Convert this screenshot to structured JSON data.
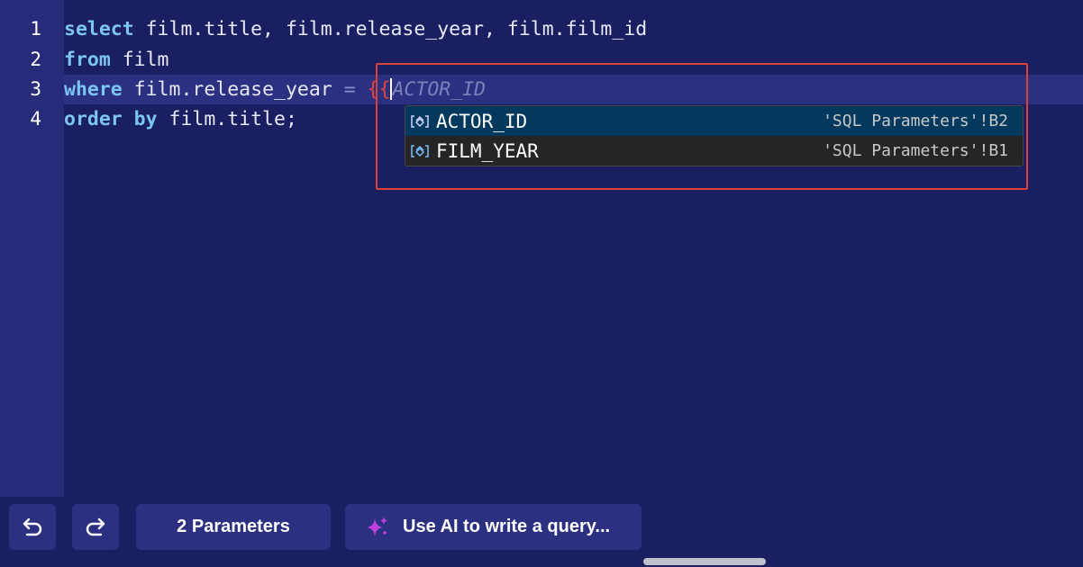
{
  "editor": {
    "line_numbers": [
      "1",
      "2",
      "3",
      "4"
    ],
    "line1": {
      "kw": "select",
      "rest": " film.title, film.release_year, film.film_id"
    },
    "line2": {
      "kw": "from",
      "rest": " film"
    },
    "line3": {
      "kw": "where",
      "mid": " film.release_year ",
      "op": "=",
      "sp": " ",
      "brace": "{{",
      "ghost": "ACTOR_ID"
    },
    "line4": {
      "kw": "order by",
      "rest": " film.title;"
    }
  },
  "suggestions": [
    {
      "label": "ACTOR_ID",
      "detail": "'SQL Parameters'!B2",
      "selected": true,
      "icon": "variable-icon"
    },
    {
      "label": "FILM_YEAR",
      "detail": "'SQL Parameters'!B1",
      "selected": false,
      "icon": "variable-icon"
    }
  ],
  "toolbar": {
    "undo_icon": "undo-icon",
    "redo_icon": "redo-icon",
    "parameters_label": "2 Parameters",
    "ai_label": "Use AI to write a query...",
    "ai_icon": "sparkle-icon"
  },
  "colors": {
    "background": "#1a1f62",
    "gutter": "#262c7a",
    "keyword": "#7cc4f2",
    "brace": "#e0453c",
    "highlight_border": "#d9433a",
    "suggestion_selected": "#04395e",
    "button_bg": "#2b3180",
    "sparkle": "#c13fe0"
  }
}
